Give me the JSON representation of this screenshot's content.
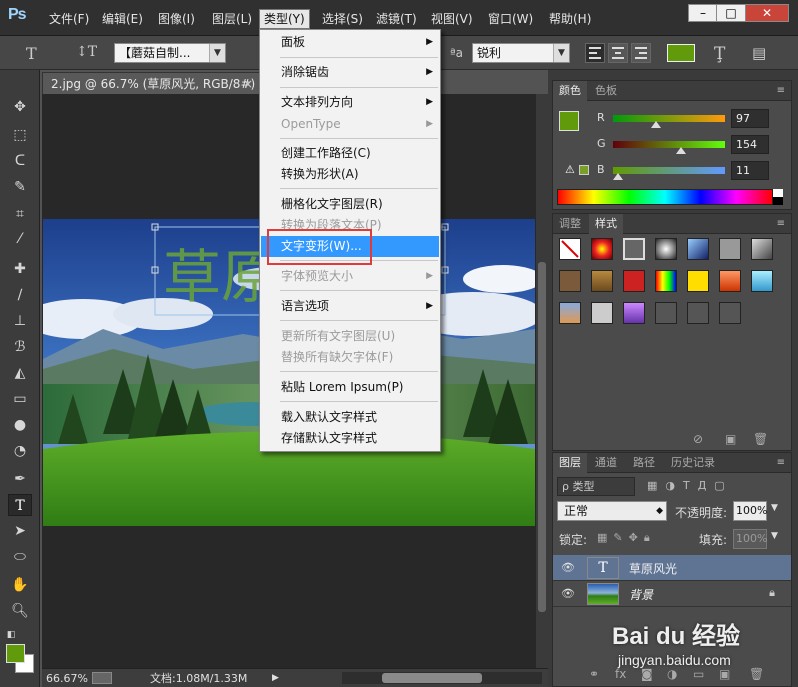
{
  "app": {
    "logo": "Ps"
  },
  "menubar": {
    "items": [
      "文件(F)",
      "编辑(E)",
      "图像(I)",
      "图层(L)",
      "类型(Y)",
      "选择(S)",
      "滤镜(T)",
      "视图(V)",
      "窗口(W)",
      "帮助(H)"
    ],
    "active": "类型(Y)",
    "window_buttons": [
      "–",
      "□",
      "✕"
    ]
  },
  "options_bar": {
    "font_family": "【蘑菇自制...",
    "aa_label": "ªa",
    "antialias": "锐利",
    "color": "#619a0b"
  },
  "document": {
    "tab_title": "2.jpg @ 66.7% (草原风光, RGB/8#) *",
    "tab_close": "×",
    "canvas_text": "草原"
  },
  "type_menu": {
    "items": [
      {
        "label": "面板",
        "submenu": true,
        "disabled": false
      },
      {
        "label": "消除锯齿",
        "submenu": true,
        "disabled": false
      },
      {
        "label": "文本排列方向",
        "submenu": true,
        "disabled": false
      },
      {
        "label": "OpenType",
        "submenu": true,
        "disabled": true
      },
      {
        "label": "创建工作路径(C)",
        "submenu": false,
        "disabled": false
      },
      {
        "label": "转换为形状(A)",
        "submenu": false,
        "disabled": false
      },
      {
        "label": "栅格化文字图层(R)",
        "submenu": false,
        "disabled": false
      },
      {
        "label": "转换为段落文本(P)",
        "submenu": false,
        "disabled": true
      },
      {
        "label": "文字变形(W)...",
        "submenu": false,
        "disabled": false,
        "highlighted": true
      },
      {
        "label": "字体预览大小",
        "submenu": true,
        "disabled": true
      },
      {
        "label": "语言选项",
        "submenu": true,
        "disabled": false
      },
      {
        "label": "更新所有文字图层(U)",
        "submenu": false,
        "disabled": true
      },
      {
        "label": "替换所有缺欠字体(F)",
        "submenu": false,
        "disabled": true
      },
      {
        "label": "粘贴 Lorem Ipsum(P)",
        "submenu": false,
        "disabled": false
      },
      {
        "label": "载入默认文字样式",
        "submenu": false,
        "disabled": false
      },
      {
        "label": "存储默认文字样式",
        "submenu": false,
        "disabled": false
      }
    ]
  },
  "color_panel": {
    "tabs": [
      "颜色",
      "色板"
    ],
    "r_label": "R",
    "g_label": "G",
    "b_label": "B",
    "r": "97",
    "g": "154",
    "b": "11",
    "r_value": 97,
    "g_value": 154,
    "b_value": 11,
    "swatch": "#619a0b"
  },
  "styles_panel": {
    "tabs": [
      "调整",
      "样式"
    ]
  },
  "layers_panel": {
    "tabs": [
      "图层",
      "通道",
      "路径",
      "历史记录"
    ],
    "filter_label": "ρ 类型",
    "blend_mode": "正常",
    "opacity_label": "不透明度:",
    "opacity": "100%",
    "lock_label": "锁定:",
    "fill_label": "填充:",
    "fill": "100%",
    "layers": [
      {
        "name": "草原风光",
        "kind": "text",
        "selected": true,
        "thumb_glyph": "T"
      },
      {
        "name": "背景",
        "kind": "image",
        "selected": false
      }
    ]
  },
  "status_bar": {
    "zoom": "66.67%",
    "doc_info": "文档:1.08M/1.33M"
  },
  "watermark": {
    "brand": "Bai du 经验",
    "url": "jingyan.baidu.com"
  }
}
